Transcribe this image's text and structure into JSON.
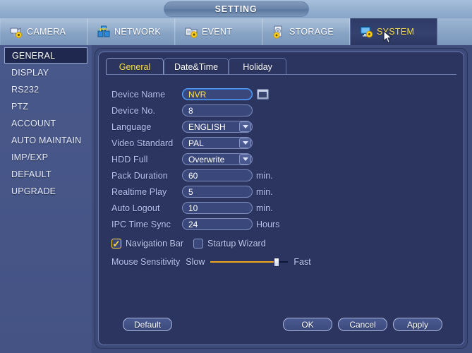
{
  "window": {
    "title": "SETTING"
  },
  "topnav": {
    "items": [
      {
        "label": "CAMERA",
        "icon": "camera-icon",
        "active": false
      },
      {
        "label": "NETWORK",
        "icon": "network-icon",
        "active": false
      },
      {
        "label": "EVENT",
        "icon": "event-icon",
        "active": false
      },
      {
        "label": "STORAGE",
        "icon": "storage-icon",
        "active": false
      },
      {
        "label": "SYSTEM",
        "icon": "system-icon",
        "active": true
      }
    ]
  },
  "sidebar": {
    "items": [
      {
        "label": "GENERAL",
        "active": true
      },
      {
        "label": "DISPLAY",
        "active": false
      },
      {
        "label": "RS232",
        "active": false
      },
      {
        "label": "PTZ",
        "active": false
      },
      {
        "label": "ACCOUNT",
        "active": false
      },
      {
        "label": "AUTO MAINTAIN",
        "active": false
      },
      {
        "label": "IMP/EXP",
        "active": false
      },
      {
        "label": "DEFAULT",
        "active": false
      },
      {
        "label": "UPGRADE",
        "active": false
      }
    ]
  },
  "tabs": [
    {
      "label": "General",
      "active": true
    },
    {
      "label": "Date&Time",
      "active": false
    },
    {
      "label": "Holiday",
      "active": false
    }
  ],
  "form": {
    "device_name": {
      "label": "Device Name",
      "value": "NVR",
      "focused": true
    },
    "device_no": {
      "label": "Device No.",
      "value": "8"
    },
    "language": {
      "label": "Language",
      "value": "ENGLISH"
    },
    "video_standard": {
      "label": "Video Standard",
      "value": "PAL"
    },
    "hdd_full": {
      "label": "HDD Full",
      "value": "Overwrite"
    },
    "pack_duration": {
      "label": "Pack Duration",
      "value": "60",
      "suffix": "min."
    },
    "realtime_play": {
      "label": "Realtime Play",
      "value": "5",
      "suffix": "min."
    },
    "auto_logout": {
      "label": "Auto Logout",
      "value": "10",
      "suffix": "min."
    },
    "ipc_time_sync": {
      "label": "IPC Time Sync",
      "value": "24",
      "suffix": "Hours"
    },
    "navigation_bar": {
      "label": "Navigation Bar",
      "checked": true
    },
    "startup_wizard": {
      "label": "Startup Wizard",
      "checked": false
    },
    "mouse_sensitivity": {
      "label": "Mouse Sensitivity",
      "min_label": "Slow",
      "max_label": "Fast",
      "percent": 85
    }
  },
  "buttons": {
    "default": "Default",
    "ok": "OK",
    "cancel": "Cancel",
    "apply": "Apply"
  },
  "colors": {
    "accent_yellow": "#ffe34d",
    "panel_bg": "#2c3560",
    "label_text": "#b9c4ef",
    "slider_fill": "#f0a818",
    "focus_border": "#5fa7ff"
  }
}
